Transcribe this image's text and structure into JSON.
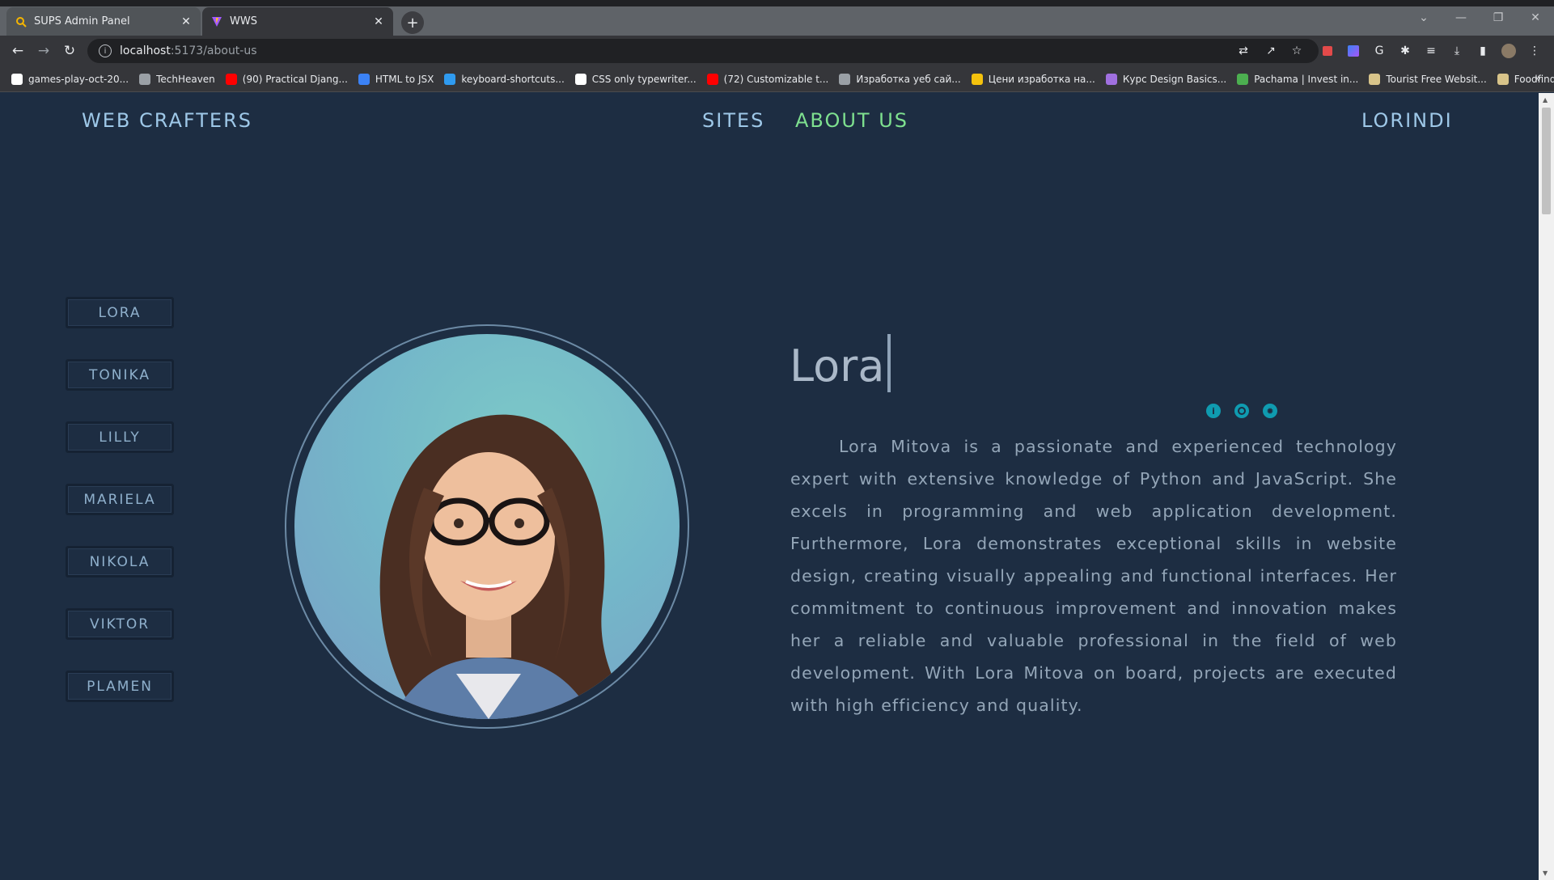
{
  "browser": {
    "tabs": [
      {
        "title": "SUPS Admin Panel",
        "icon": "search-magnifier-icon",
        "active": false
      },
      {
        "title": "WWS",
        "icon": "vite-icon",
        "active": true
      }
    ],
    "url": {
      "host": "localhost",
      "path": ":5173/about-us"
    },
    "bookmarks": [
      {
        "label": "games-play-oct-20...",
        "color": "#ffffff"
      },
      {
        "label": "TechHeaven",
        "color": "#9aa0a6"
      },
      {
        "label": "(90) Practical Djang...",
        "color": "#ff0000"
      },
      {
        "label": "HTML to JSX",
        "color": "#3b82f6"
      },
      {
        "label": "keyboard-shortcuts...",
        "color": "#2f9bf0"
      },
      {
        "label": "CSS only typewriter...",
        "color": "#ffffff"
      },
      {
        "label": "(72) Customizable t...",
        "color": "#ff0000"
      },
      {
        "label": "Изработка уеб сай...",
        "color": "#9aa0a6"
      },
      {
        "label": "Цени изработка на...",
        "color": "#f4c20d"
      },
      {
        "label": "Курс Design Basics...",
        "color": "#a070e0"
      },
      {
        "label": "Pachama | Invest in...",
        "color": "#4caf50"
      },
      {
        "label": "Tourist Free Websit...",
        "color": "#d8c48a"
      },
      {
        "label": "Foodfinda Free We...",
        "color": "#d8c48a"
      }
    ]
  },
  "site": {
    "brand": "WEB CRAFTERS",
    "nav": {
      "sites": "SITES",
      "about": "ABOUT US",
      "user": "LORINDI"
    },
    "members": [
      "LORA",
      "TONIKA",
      "LILLY",
      "MARIELA",
      "NIKOLA",
      "VIKTOR",
      "PLAMEN"
    ],
    "profile": {
      "name": "Lora",
      "bio": "Lora Mitova is a passionate and experienced technology expert with extensive knowledge of Python and JavaScript. She excels in programming and web application development. Furthermore, Lora demonstrates exceptional skills in website design, creating visually appealing and functional interfaces. Her commitment to continuous improvement and innovation makes her a reliable and valuable professional in the field of web development. With Lora Mitova on board, projects are executed with high efficiency and quality."
    },
    "colors": {
      "background": "#1d2d42",
      "accent": "#7ee08f",
      "link": "#9ec8e8",
      "social": "#0f9bb0"
    }
  }
}
